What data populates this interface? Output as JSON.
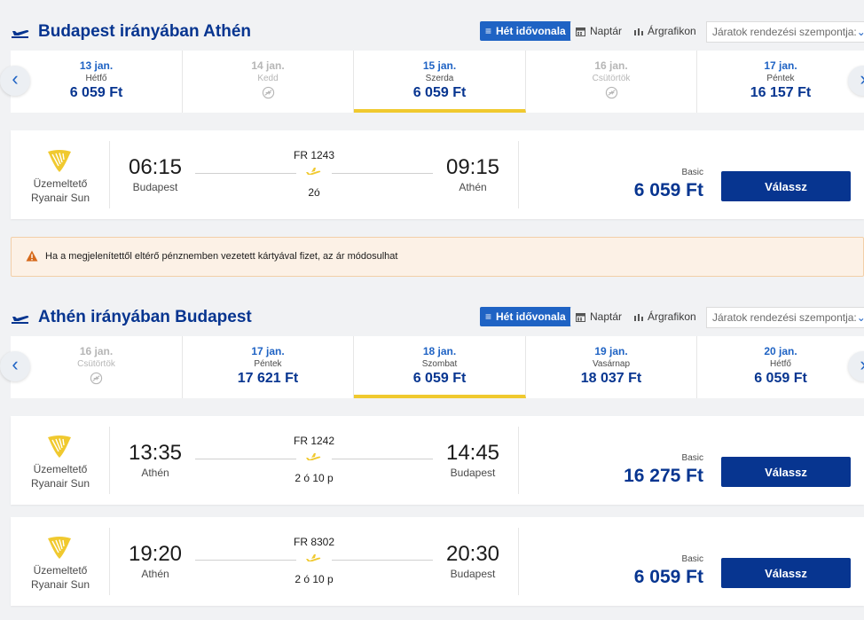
{
  "view_buttons": {
    "timeline": "Hét idővonala",
    "calendar": "Naptár",
    "graph": "Árgrafikon",
    "sort_placeholder": "Járatok rendezési szempontja:"
  },
  "outbound": {
    "title": "Budapest irányában Athén",
    "dates": [
      {
        "date": "13 jan.",
        "weekday": "Hétfő",
        "price": "6 059 Ft",
        "available": true,
        "selected": false
      },
      {
        "date": "14 jan.",
        "weekday": "Kedd",
        "price": "",
        "available": false,
        "selected": false
      },
      {
        "date": "15 jan.",
        "weekday": "Szerda",
        "price": "6 059 Ft",
        "available": true,
        "selected": true
      },
      {
        "date": "16 jan.",
        "weekday": "Csütörtök",
        "price": "",
        "available": false,
        "selected": false
      },
      {
        "date": "17 jan.",
        "weekday": "Péntek",
        "price": "16 157 Ft",
        "available": true,
        "selected": false
      }
    ],
    "flights": [
      {
        "operator_label": "Üzemeltető",
        "operator": "Ryanair Sun",
        "dep_time": "06:15",
        "dep_city": "Budapest",
        "flight_no": "FR 1243",
        "duration": "2ó",
        "arr_time": "09:15",
        "arr_city": "Athén",
        "fare": "Basic",
        "price": "6 059 Ft",
        "button": "Válassz"
      }
    ]
  },
  "warning": "Ha a megjelenítettől eltérő pénznemben vezetett kártyával fizet, az ár módosulhat",
  "inbound": {
    "title": "Athén irányában Budapest",
    "dates": [
      {
        "date": "16 jan.",
        "weekday": "Csütörtök",
        "price": "",
        "available": false,
        "selected": false
      },
      {
        "date": "17 jan.",
        "weekday": "Péntek",
        "price": "17 621 Ft",
        "available": true,
        "selected": false
      },
      {
        "date": "18 jan.",
        "weekday": "Szombat",
        "price": "6 059 Ft",
        "available": true,
        "selected": true
      },
      {
        "date": "19 jan.",
        "weekday": "Vasárnap",
        "price": "18 037 Ft",
        "available": true,
        "selected": false
      },
      {
        "date": "20 jan.",
        "weekday": "Hétfő",
        "price": "6 059 Ft",
        "available": true,
        "selected": false
      }
    ],
    "flights": [
      {
        "operator_label": "Üzemeltető",
        "operator": "Ryanair Sun",
        "dep_time": "13:35",
        "dep_city": "Athén",
        "flight_no": "FR 1242",
        "duration": "2 ó 10 p",
        "arr_time": "14:45",
        "arr_city": "Budapest",
        "fare": "Basic",
        "price": "16 275 Ft",
        "button": "Válassz"
      },
      {
        "operator_label": "Üzemeltető",
        "operator": "Ryanair Sun",
        "dep_time": "19:20",
        "dep_city": "Athén",
        "flight_no": "FR 8302",
        "duration": "2 ó 10 p",
        "arr_time": "20:30",
        "arr_city": "Budapest",
        "fare": "Basic",
        "price": "6 059 Ft",
        "button": "Válassz"
      }
    ]
  },
  "colors": {
    "brand_blue": "#073590",
    "accent_blue": "#1f63c4",
    "selected_underline": "#f0c92f",
    "warning_bg": "#fcf1e6",
    "warning_icon": "#d6691a"
  },
  "icons": [
    "plane-takeoff-icon",
    "list-icon",
    "calendar-icon",
    "bar-chart-icon",
    "chevron-down-icon",
    "chevron-left-icon",
    "chevron-right-icon",
    "no-flight-icon",
    "ryanair-harp-logo",
    "plane-icon",
    "warning-icon"
  ]
}
